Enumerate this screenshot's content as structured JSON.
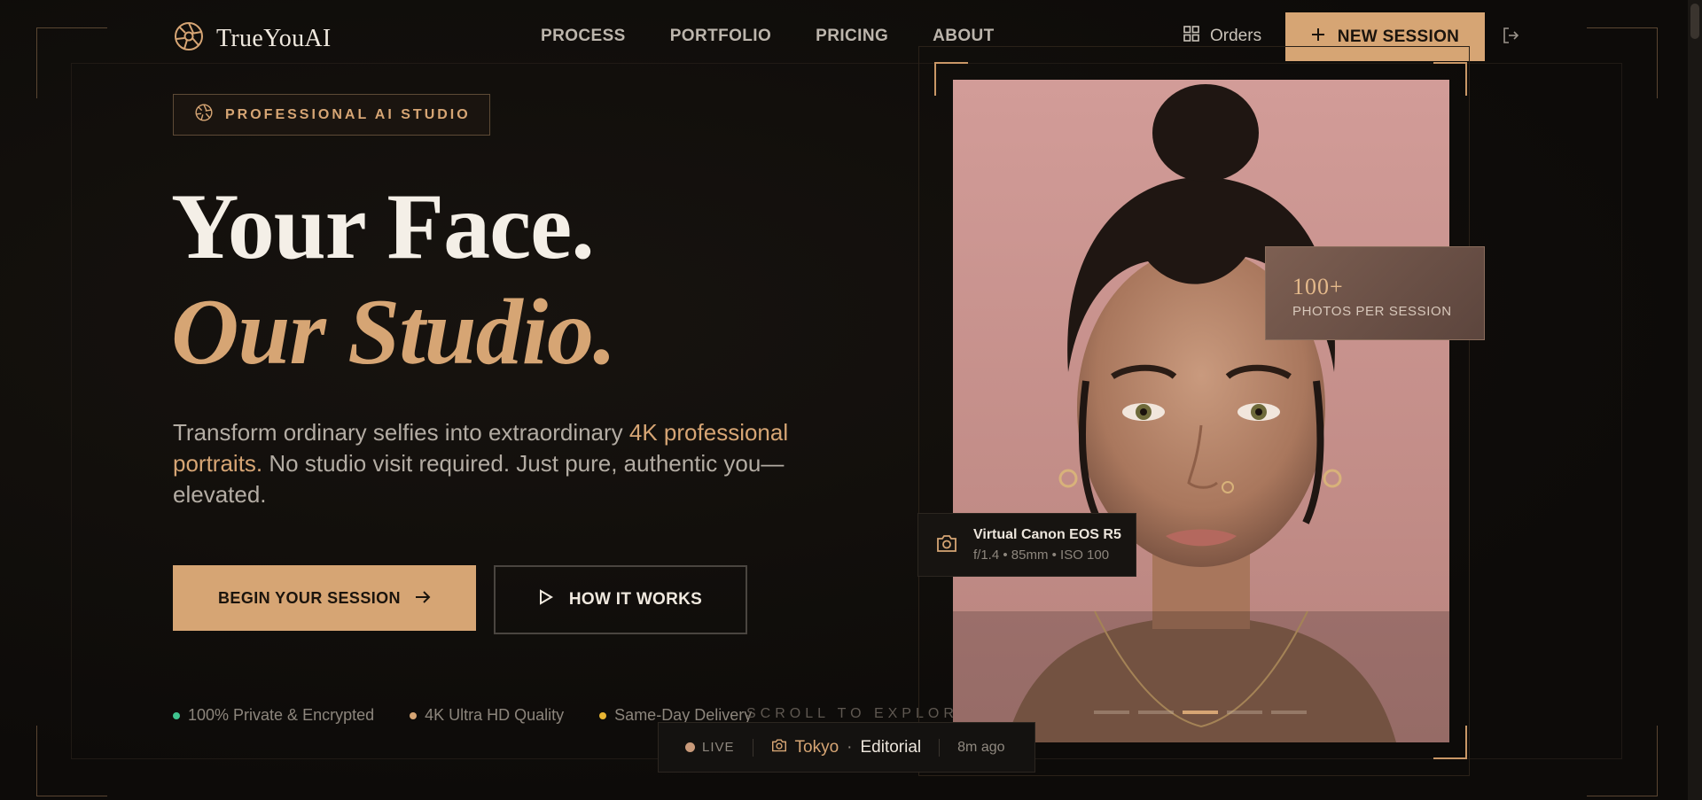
{
  "brand": {
    "name": "TrueYouAI"
  },
  "nav": {
    "links": [
      "PROCESS",
      "PORTFOLIO",
      "PRICING",
      "ABOUT"
    ],
    "orders_label": "Orders",
    "new_session_label": "NEW SESSION"
  },
  "hero": {
    "badge": "PROFESSIONAL AI STUDIO",
    "headline_line1": "Your Face.",
    "headline_line2": "Our Studio.",
    "lead_before": "Transform ordinary selfies into extraordinary ",
    "lead_highlight": "4K professional portraits.",
    "lead_after": " No studio visit required. Just pure, authentic you—elevated.",
    "cta_primary": "BEGIN YOUR SESSION",
    "cta_secondary": "HOW IT WORKS"
  },
  "features": [
    {
      "label": "100% Private & Encrypted",
      "color": "#3fc48f"
    },
    {
      "label": "4K Ultra HD Quality",
      "color": "#d6a574"
    },
    {
      "label": "Same-Day Delivery",
      "color": "#e8b533"
    }
  ],
  "scroll_hint": "SCROLL TO EXPLORE",
  "stat": {
    "value": "100+",
    "label": "PHOTOS PER SESSION"
  },
  "camera": {
    "title": "Virtual Canon EOS R5",
    "specs": "f/1.4 • 85mm • ISO 100"
  },
  "carousel": {
    "count": 5,
    "active_index": 2
  },
  "live_feed": {
    "status": "LIVE",
    "city": "Tokyo",
    "separator": "·",
    "category": "Editorial",
    "time_ago": "8m ago"
  },
  "colors": {
    "accent": "#d6a574",
    "background": "#0d0b09"
  },
  "icons": [
    "aperture-icon",
    "grid-icon",
    "plus-icon",
    "logout-icon",
    "arrow-right-icon",
    "play-icon",
    "camera-icon"
  ]
}
